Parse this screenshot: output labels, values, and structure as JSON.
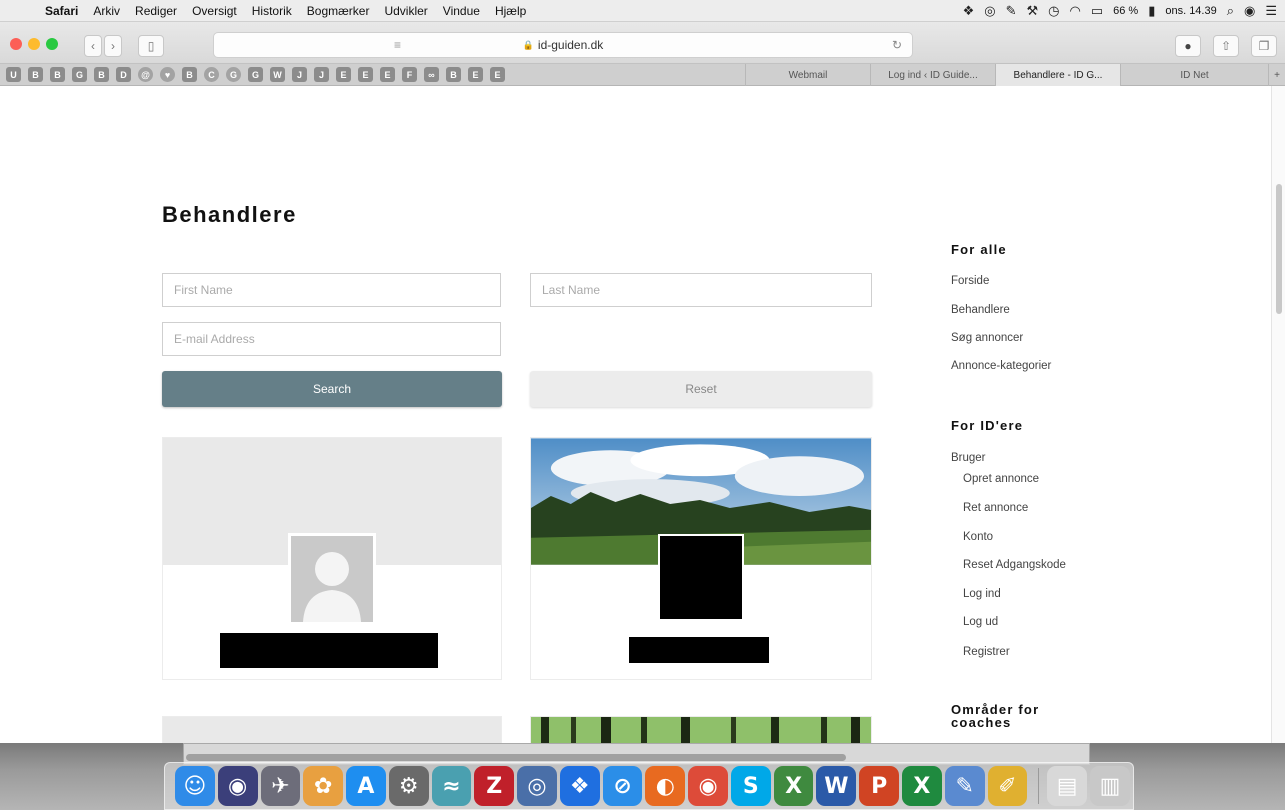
{
  "menubar": {
    "apple_glyph": "",
    "items": [
      "Safari",
      "Arkiv",
      "Rediger",
      "Oversigt",
      "Historik",
      "Bogmærker",
      "Udvikler",
      "Vindue",
      "Hjælp"
    ],
    "battery": "66 %",
    "clock": "ons. 14.39",
    "status_icons": [
      "dropbox-icon",
      "sync-icon",
      "pen-icon",
      "tool-icon",
      "time-machine-icon",
      "wifi-icon",
      "airplay-icon",
      "battery-icon",
      "search-icon",
      "siri-icon",
      "notification-icon"
    ]
  },
  "toolbar": {
    "address": "id-guiden.dk",
    "lock_glyph": "🔒",
    "back_glyph": "‹",
    "forward_glyph": "›",
    "sidebar_glyph": "▯",
    "reader_glyph": "≡",
    "reload_glyph": "↻",
    "share_glyph": "⇧",
    "tabs_glyph": "❐",
    "ext_glyph": "●"
  },
  "bookmarks": [
    "U",
    "B",
    "B",
    "G",
    "B",
    "D",
    "@",
    "♥",
    "B",
    "C",
    "G",
    "G",
    "W",
    "J",
    "J",
    "E",
    "E",
    "E",
    "F",
    "∞",
    "B",
    "E",
    "E"
  ],
  "tabs": [
    {
      "title": "Webmail",
      "active": false
    },
    {
      "title": "Log ind ‹ ID Guide...",
      "active": false
    },
    {
      "title": "Behandlere - ID G...",
      "active": true
    },
    {
      "title": "ID Net",
      "active": false
    }
  ],
  "new_tab_glyph": "+",
  "page": {
    "title": "Behandlere",
    "form": {
      "first_name_placeholder": "First Name",
      "last_name_placeholder": "Last Name",
      "email_placeholder": "E-mail Address",
      "search_label": "Search",
      "reset_label": "Reset"
    }
  },
  "sidebar": {
    "section1": {
      "heading": "For alle",
      "links": [
        "Forside",
        "Behandlere",
        "Søg annoncer",
        "Annonce-kategorier"
      ]
    },
    "section2": {
      "heading": "For ID'ere",
      "parent": "Bruger",
      "children": [
        "Opret annonce",
        "Ret annonce",
        "Konto",
        "Reset Adgangskode",
        "Log ind",
        "Log ud",
        "Registrer"
      ]
    },
    "section3": {
      "heading": "Områder for coaches"
    }
  },
  "colors": {
    "search_button": "#657f88",
    "reset_button": "#ececec"
  },
  "dock": {
    "icons": [
      {
        "name": "finder-icon",
        "color": "#2f8be8",
        "glyph": "☺"
      },
      {
        "name": "siri-icon",
        "color": "#3b3f7a",
        "glyph": "◉"
      },
      {
        "name": "launchpad-icon",
        "color": "#6d6d7a",
        "glyph": "✈"
      },
      {
        "name": "photos-icon",
        "color": "#e8a040",
        "glyph": "✿"
      },
      {
        "name": "app-store-icon",
        "color": "#1e8ef0",
        "glyph": "A"
      },
      {
        "name": "system-preferences-icon",
        "color": "#6a6a6a",
        "glyph": "⚙"
      },
      {
        "name": "preview-icon",
        "color": "#4aa0b0",
        "glyph": "≈"
      },
      {
        "name": "filezilla-icon",
        "color": "#c0202a",
        "glyph": "Z"
      },
      {
        "name": "network-icon",
        "color": "#4a6fa8",
        "glyph": "◎"
      },
      {
        "name": "dropbox-icon",
        "color": "#1f6fe0",
        "glyph": "❖"
      },
      {
        "name": "safari-icon",
        "color": "#2b8ee8",
        "glyph": "⊘"
      },
      {
        "name": "firefox-icon",
        "color": "#e86a20",
        "glyph": "◐"
      },
      {
        "name": "chrome-icon",
        "color": "#dd4b39",
        "glyph": "◉"
      },
      {
        "name": "skype-icon",
        "color": "#00a8e8",
        "glyph": "S"
      },
      {
        "name": "excel-mac-icon",
        "color": "#3f8a3f",
        "glyph": "X"
      },
      {
        "name": "word-icon",
        "color": "#2b5aa8",
        "glyph": "W"
      },
      {
        "name": "powerpoint-icon",
        "color": "#d04423",
        "glyph": "P"
      },
      {
        "name": "excel-icon",
        "color": "#1f8a3f",
        "glyph": "X"
      },
      {
        "name": "textedit-icon",
        "color": "#5a8ad0",
        "glyph": "✎"
      },
      {
        "name": "stickies-icon",
        "color": "#e0b030",
        "glyph": "✐"
      }
    ],
    "trailing_icons": [
      {
        "name": "document-icon",
        "color": "#d8d8d8",
        "glyph": "▤"
      },
      {
        "name": "trash-icon",
        "color": "#c8c8c8",
        "glyph": "▥"
      }
    ]
  }
}
